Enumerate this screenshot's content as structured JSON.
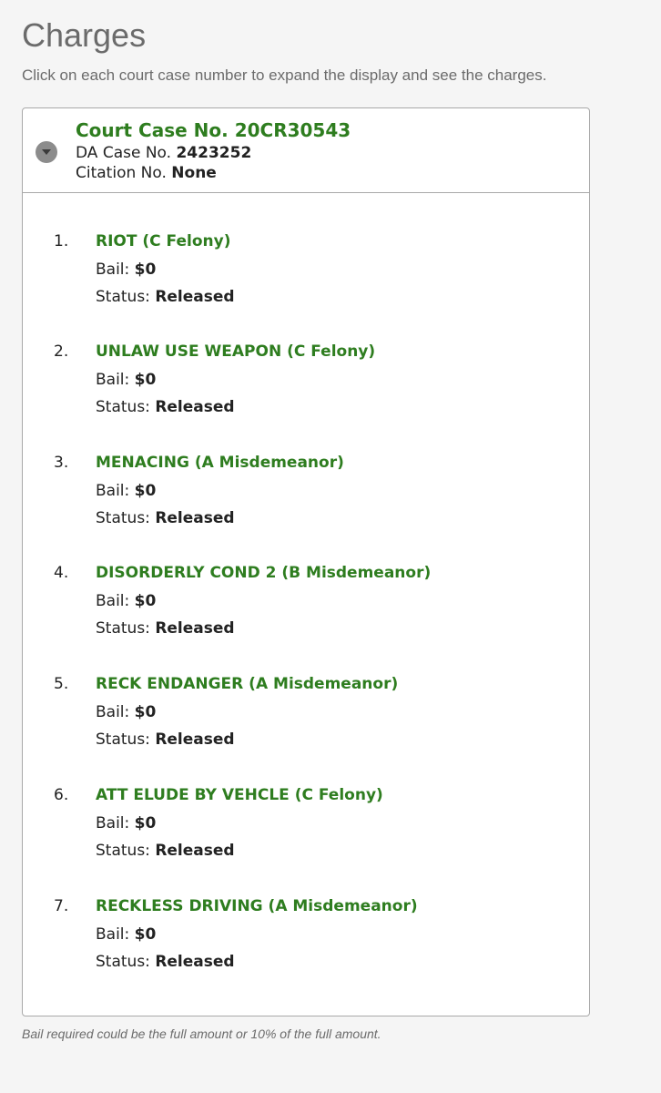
{
  "header": {
    "title": "Charges",
    "instructions": "Click on each court case number to expand the display and see the charges."
  },
  "case": {
    "court_case": "Court Case No. 20CR30543",
    "da_label": "DA Case No.",
    "da_value": "2423252",
    "citation_label": "Citation No.",
    "citation_value": "None",
    "toggle_icon": "chevron-down-icon"
  },
  "labels": {
    "bail": "Bail:",
    "status": "Status:"
  },
  "charges": [
    {
      "num": "1.",
      "name": "RIOT (C Felony)",
      "bail": "$0",
      "status": "Released"
    },
    {
      "num": "2.",
      "name": "UNLAW USE WEAPON (C Felony)",
      "bail": "$0",
      "status": "Released"
    },
    {
      "num": "3.",
      "name": "MENACING (A Misdemeanor)",
      "bail": "$0",
      "status": "Released"
    },
    {
      "num": "4.",
      "name": "DISORDERLY COND 2 (B Misdemeanor)",
      "bail": "$0",
      "status": "Released"
    },
    {
      "num": "5.",
      "name": "RECK ENDANGER (A Misdemeanor)",
      "bail": "$0",
      "status": "Released"
    },
    {
      "num": "6.",
      "name": "ATT ELUDE BY VEHCLE (C Felony)",
      "bail": "$0",
      "status": "Released"
    },
    {
      "num": "7.",
      "name": "RECKLESS DRIVING (A Misdemeanor)",
      "bail": "$0",
      "status": "Released"
    }
  ],
  "footnote": "Bail required could be the full amount or 10% of the full amount.",
  "colors": {
    "accent_green": "#2e7d1f",
    "muted_text": "#6b6b6b",
    "panel_border": "#a9a9a9"
  }
}
